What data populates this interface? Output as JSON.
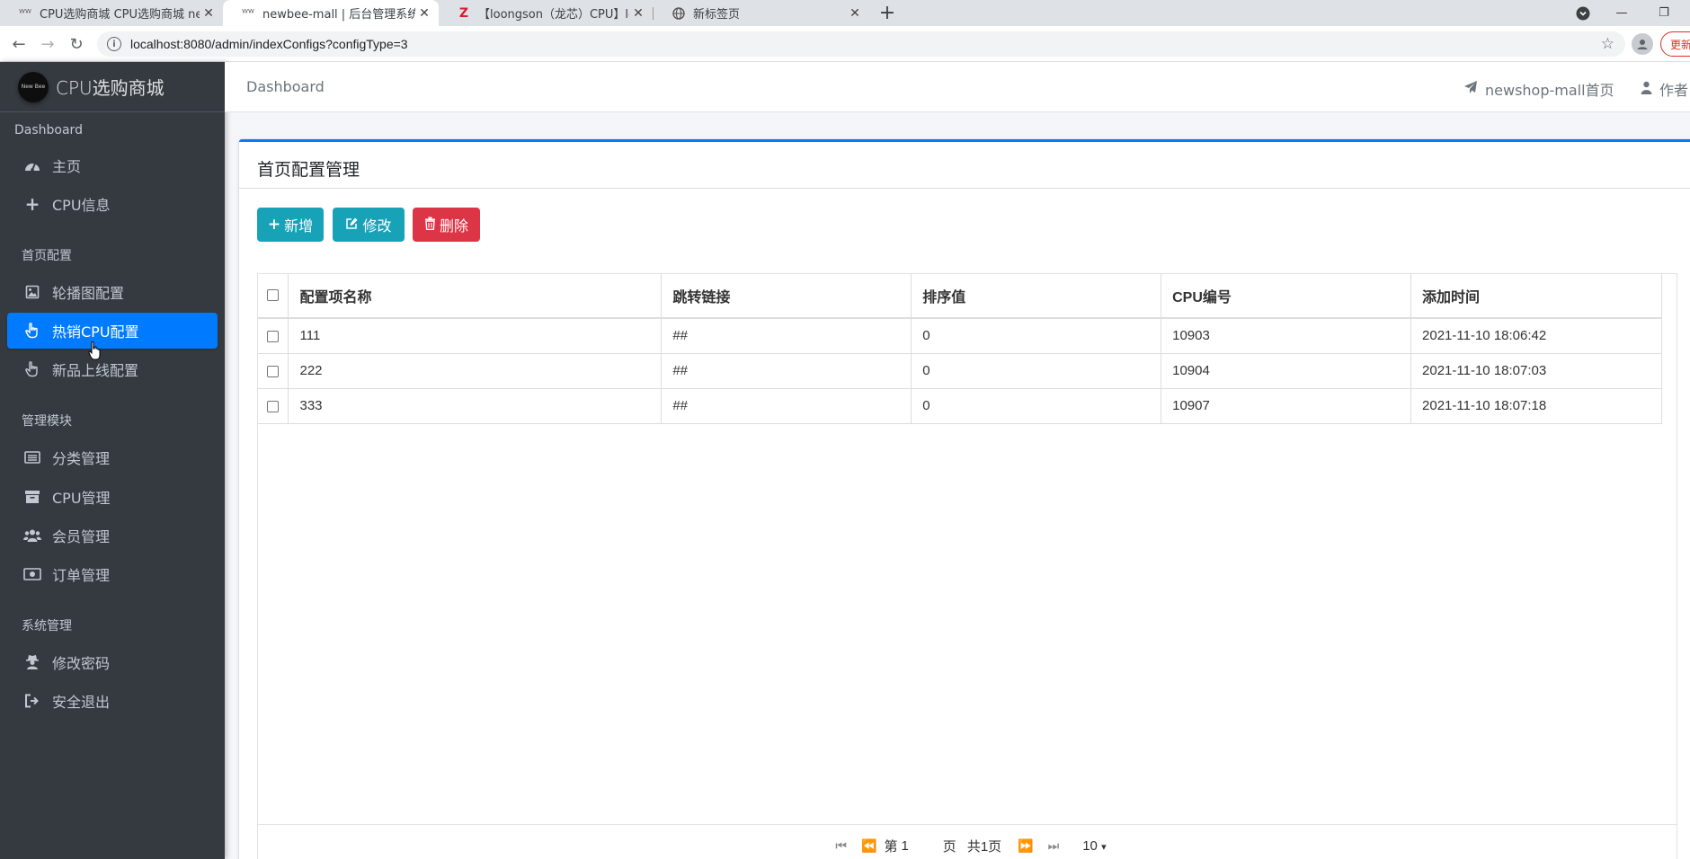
{
  "browser": {
    "tabs": [
      {
        "title": "CPU选购商城 CPU选购商城 newbee",
        "icon": "newbee"
      },
      {
        "title": "newbee-mall | 后台管理系统",
        "icon": "newbee"
      },
      {
        "title": "【loongson（龙芯）CPU】loon",
        "icon": "Z"
      },
      {
        "title": "新标签页",
        "icon": "globe"
      }
    ],
    "url": "localhost:8080/admin/indexConfigs?configType=3",
    "update_label": "更新"
  },
  "sidebar": {
    "brand_logo_text": "New Bee",
    "brand": "CPU选购商城",
    "sections": [
      {
        "header": "Dashboard",
        "items": [
          "主页",
          "CPU信息"
        ]
      },
      {
        "header": "首页配置",
        "items": [
          "轮播图配置",
          "热销CPU配置",
          "新品上线配置"
        ]
      },
      {
        "header": "管理模块",
        "items": [
          "分类管理",
          "CPU管理",
          "会员管理",
          "订单管理"
        ]
      },
      {
        "header": "系统管理",
        "items": [
          "修改密码",
          "安全退出"
        ]
      }
    ]
  },
  "topnav": {
    "breadcrumb": "Dashboard",
    "home_link": "newshop-mall首页",
    "author_link": "作者"
  },
  "card": {
    "title": "首页配置管理",
    "buttons": {
      "add": "新增",
      "edit": "修改",
      "delete": "删除"
    },
    "columns": [
      "配置项名称",
      "跳转链接",
      "排序值",
      "CPU编号",
      "添加时间"
    ],
    "rows": [
      [
        "111",
        "##",
        "0",
        "10903",
        "2021-11-10 18:06:42"
      ],
      [
        "222",
        "##",
        "0",
        "10904",
        "2021-11-10 18:07:03"
      ],
      [
        "333",
        "##",
        "0",
        "10907",
        "2021-11-10 18:07:18"
      ]
    ],
    "pager": {
      "page_prefix": "第",
      "page": "1",
      "page_suffix": "页",
      "total": "共1页",
      "page_size": "10"
    }
  },
  "colors": {
    "accent": "#007bff",
    "info": "#17a2b8",
    "danger": "#dc3545",
    "sidebar": "#343a40"
  }
}
